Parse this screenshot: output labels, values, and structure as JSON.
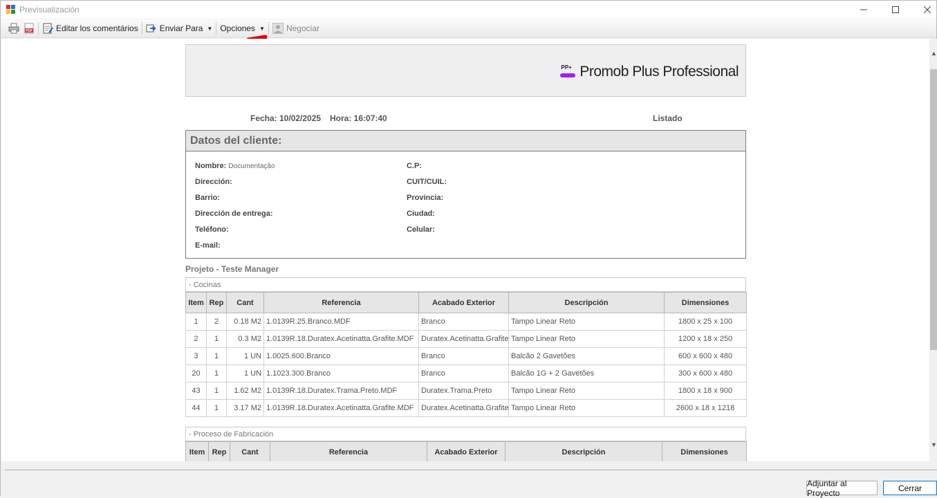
{
  "window": {
    "title": "Previsualización"
  },
  "toolbar": {
    "edit_comments": "Editar los comentários",
    "send_to": "Enviar Para",
    "options": "Opciones",
    "negotiate": "Negociar"
  },
  "report": {
    "brand": "Promob Plus Professional",
    "brand_mark": "PP+",
    "date": "Fecha: 10/02/2025",
    "time": "Hora: 16:07:40",
    "listing": "Listado",
    "client_title": "Datos del cliente:",
    "fields": {
      "nombre": "Nombre:",
      "nombre_val": "Documentação",
      "direccion": "Dirección:",
      "barrio": "Barrio:",
      "direccion_entrega": "Dirección de entrega:",
      "telefono": "Teléfono:",
      "email": "E-mail:",
      "cp": "C.P:",
      "cuit": "CUIT/CUIL:",
      "provincia": "Provincia:",
      "ciudad": "Ciudad:",
      "celular": "Celular:"
    },
    "project": "Projeto - Teste Manager",
    "columns": [
      "Item",
      "Rep",
      "Cant",
      "Referencia",
      "Acabado Exterior",
      "Descripción",
      "Dimensiones"
    ],
    "section1": {
      "title": "- Cocinas",
      "rows": [
        [
          "1",
          "2",
          "0.18 M2",
          "1.0139R.25.Branco.MDF",
          "Branco",
          "Tampo Linear Reto",
          "1800 x 25 x 100"
        ],
        [
          "2",
          "1",
          "0.3 M2",
          "1.0139R.18.Duratex.Acetinatta.Grafite.MDF",
          "Duratex.Acetinatta.Grafite",
          "Tampo Linear Reto",
          "1200 x 18 x 250"
        ],
        [
          "3",
          "1",
          "1 UN",
          "1.0025.600.Branco",
          "Branco",
          "Balcão 2 Gavetões",
          "600 x 600 x 480"
        ],
        [
          "20",
          "1",
          "1 UN",
          "1.1023.300.Branco",
          "Branco",
          "Balcão 1G + 2 Gavetões",
          "300 x 600 x 480"
        ],
        [
          "43",
          "1",
          "1.62 M2",
          "1.0139R.18.Duratex.Trama.Preto.MDF",
          "Duratex.Trama.Preto",
          "Tampo Linear Reto",
          "1800 x 18 x 900"
        ],
        [
          "44",
          "1",
          "3.17 M2",
          "1.0139R.18.Duratex.Acetinatta.Grafite.MDF",
          "Duratex.Acetinatta.Grafite",
          "Tampo Linear Reto",
          "2600 x 18 x 1218"
        ]
      ]
    },
    "section2": {
      "title": "- Proceso de Fabricación"
    }
  },
  "buttons": {
    "adjust": "Adjuntar al Proyecto",
    "close": "Cerrar"
  }
}
